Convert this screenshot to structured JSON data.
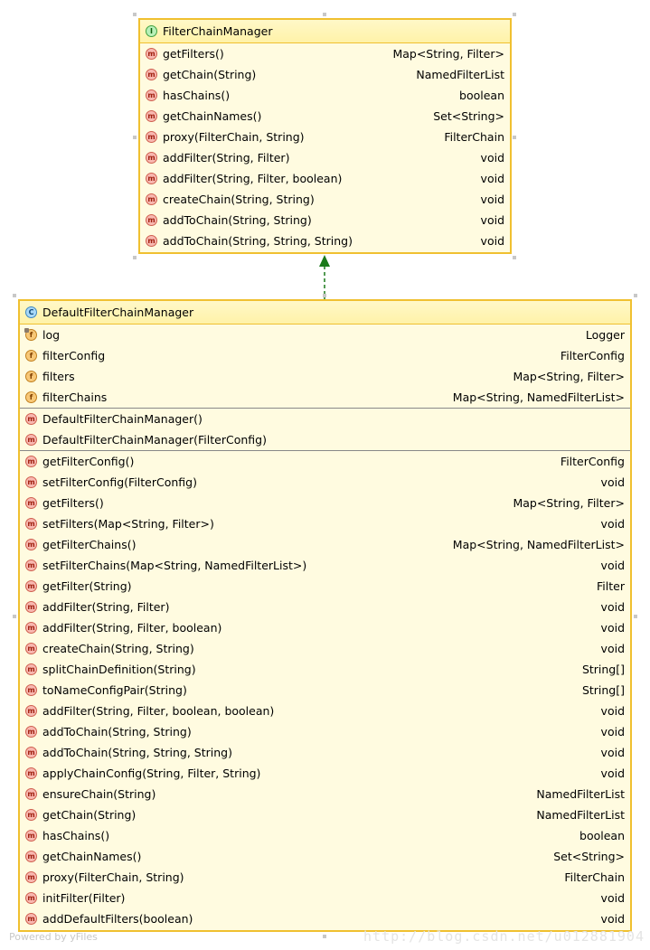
{
  "interface": {
    "kind_icon": "I",
    "name": "FilterChainManager",
    "methods": [
      {
        "icon": "m",
        "name": "getFilters()",
        "type": "Map<String, Filter>"
      },
      {
        "icon": "m",
        "name": "getChain(String)",
        "type": "NamedFilterList"
      },
      {
        "icon": "m",
        "name": "hasChains()",
        "type": "boolean"
      },
      {
        "icon": "m",
        "name": "getChainNames()",
        "type": "Set<String>"
      },
      {
        "icon": "m",
        "name": "proxy(FilterChain, String)",
        "type": "FilterChain"
      },
      {
        "icon": "m",
        "name": "addFilter(String, Filter)",
        "type": "void"
      },
      {
        "icon": "m",
        "name": "addFilter(String, Filter, boolean)",
        "type": "void"
      },
      {
        "icon": "m",
        "name": "createChain(String, String)",
        "type": "void"
      },
      {
        "icon": "m",
        "name": "addToChain(String, String)",
        "type": "void"
      },
      {
        "icon": "m",
        "name": "addToChain(String, String, String)",
        "type": "void"
      }
    ]
  },
  "class": {
    "kind_icon": "C",
    "name": "DefaultFilterChainManager",
    "fields": [
      {
        "icon": "f",
        "name": "log",
        "type": "Logger"
      },
      {
        "icon": "f",
        "name": "filterConfig",
        "type": "FilterConfig"
      },
      {
        "icon": "f",
        "name": "filters",
        "type": "Map<String, Filter>"
      },
      {
        "icon": "f",
        "name": "filterChains",
        "type": "Map<String, NamedFilterList>"
      }
    ],
    "constructors": [
      {
        "icon": "m",
        "name": "DefaultFilterChainManager()",
        "type": ""
      },
      {
        "icon": "m",
        "name": "DefaultFilterChainManager(FilterConfig)",
        "type": ""
      }
    ],
    "methods": [
      {
        "icon": "m",
        "name": "getFilterConfig()",
        "type": "FilterConfig"
      },
      {
        "icon": "m",
        "name": "setFilterConfig(FilterConfig)",
        "type": "void"
      },
      {
        "icon": "m",
        "name": "getFilters()",
        "type": "Map<String, Filter>"
      },
      {
        "icon": "m",
        "name": "setFilters(Map<String, Filter>)",
        "type": "void"
      },
      {
        "icon": "m",
        "name": "getFilterChains()",
        "type": "Map<String, NamedFilterList>"
      },
      {
        "icon": "m",
        "name": "setFilterChains(Map<String, NamedFilterList>)",
        "type": "void"
      },
      {
        "icon": "m",
        "name": "getFilter(String)",
        "type": "Filter"
      },
      {
        "icon": "m",
        "name": "addFilter(String, Filter)",
        "type": "void"
      },
      {
        "icon": "m",
        "name": "addFilter(String, Filter, boolean)",
        "type": "void"
      },
      {
        "icon": "m",
        "name": "createChain(String, String)",
        "type": "void"
      },
      {
        "icon": "m",
        "name": "splitChainDefinition(String)",
        "type": "String[]"
      },
      {
        "icon": "m",
        "name": "toNameConfigPair(String)",
        "type": "String[]"
      },
      {
        "icon": "m",
        "name": "addFilter(String, Filter, boolean, boolean)",
        "type": "void"
      },
      {
        "icon": "m",
        "name": "addToChain(String, String)",
        "type": "void"
      },
      {
        "icon": "m",
        "name": "addToChain(String, String, String)",
        "type": "void"
      },
      {
        "icon": "m",
        "name": "applyChainConfig(String, Filter, String)",
        "type": "void"
      },
      {
        "icon": "m",
        "name": "ensureChain(String)",
        "type": "NamedFilterList"
      },
      {
        "icon": "m",
        "name": "getChain(String)",
        "type": "NamedFilterList"
      },
      {
        "icon": "m",
        "name": "hasChains()",
        "type": "boolean"
      },
      {
        "icon": "m",
        "name": "getChainNames()",
        "type": "Set<String>"
      },
      {
        "icon": "m",
        "name": "proxy(FilterChain, String)",
        "type": "FilterChain"
      },
      {
        "icon": "m",
        "name": "initFilter(Filter)",
        "type": "void"
      },
      {
        "icon": "m",
        "name": "addDefaultFilters(boolean)",
        "type": "void"
      }
    ]
  },
  "relation": {
    "type": "implements",
    "color": "#1a7a1a"
  },
  "footer": {
    "yfiles": "Powered by yFiles",
    "watermark": "http://blog.csdn.net/u012881904"
  },
  "colors": {
    "border": "#f0c030",
    "fill": "#fffbe0"
  }
}
